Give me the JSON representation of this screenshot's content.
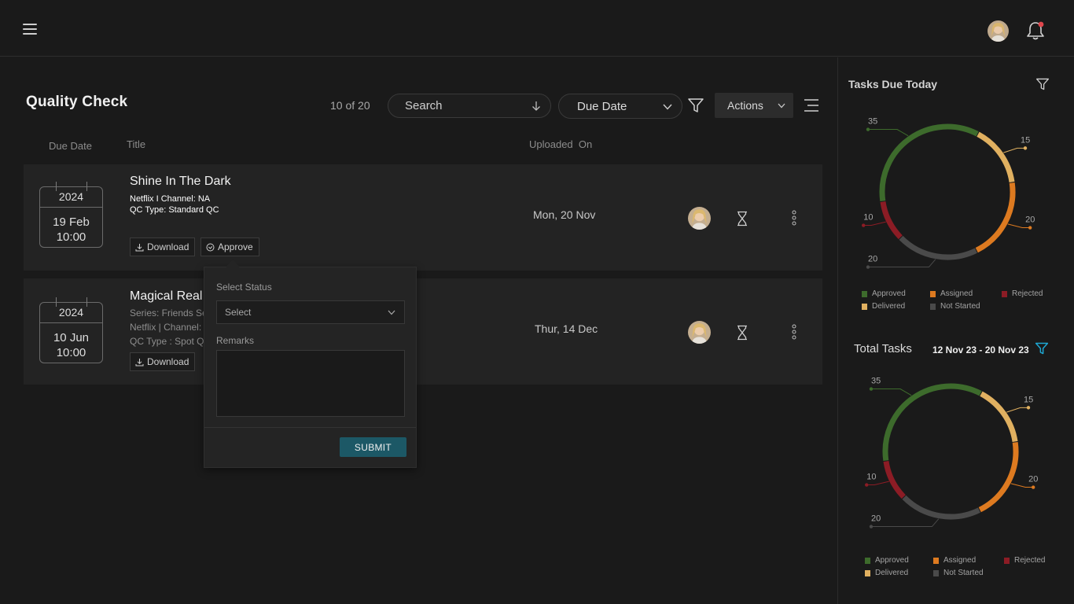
{
  "header": {
    "menu_icon": "hamburger-menu-icon",
    "avatar_icon": "user-avatar-icon",
    "bell_icon": "notification-bell-icon",
    "notification_dot_color": "#e0464c"
  },
  "toolbar": {
    "title": "Quality Check",
    "count": "10 of 20",
    "search_label": "Search",
    "sort_select": "Due Date",
    "actions_label": "Actions"
  },
  "columns": {
    "due_date": "Due Date",
    "title": "Title",
    "uploaded_on": "Uploaded  On"
  },
  "rows": [
    {
      "year": "2024",
      "day": "19 Feb",
      "time": "10:00",
      "title": "Shine In The Dark",
      "meta1": "Netflix I Channel: NA",
      "meta2": "QC Type: Standard QC",
      "uploaded": "Mon, 20 Nov",
      "download_label": "Download",
      "approve_label": "Approve"
    },
    {
      "year": "2024",
      "day": "10 Jun",
      "time": "10:00",
      "title": "Magical Real",
      "meta1": "Series: Friends Se",
      "meta2": "Netflix | Channel:",
      "meta3": "QC Type : Spot Q",
      "uploaded": "Thur, 14 Dec",
      "download_label": "Download"
    }
  ],
  "popover": {
    "status_label": "Select Status",
    "status_placeholder": "Select",
    "remarks_label": "Remarks",
    "submit_label": "SUBMIT"
  },
  "side_panel": {
    "tasks_due_today": {
      "title": "Tasks Due Today"
    },
    "total_tasks": {
      "title": "Total Tasks",
      "date_range": "12 Nov 23 - 20 Nov 23"
    },
    "legend": {
      "approved": "Approved",
      "assigned": "Assigned",
      "rejected": "Rejected",
      "delivered": "Delivered",
      "not_started": "Not Started"
    }
  },
  "colors": {
    "approved": "#3d6b2c",
    "delivered": "#e0b060",
    "assigned": "#dd7a20",
    "not_started": "#4a4a4a",
    "rejected": "#8c1c25",
    "submit": "#1c5866",
    "filter_active": "#1ea7d3"
  },
  "chart_data": [
    {
      "type": "pie",
      "title": "Tasks Due Today",
      "categories": [
        "Approved",
        "Delivered",
        "Assigned",
        "Not Started",
        "Rejected"
      ],
      "values": [
        35,
        15,
        20,
        20,
        10
      ]
    },
    {
      "type": "pie",
      "title": "Total Tasks",
      "categories": [
        "Approved",
        "Delivered",
        "Assigned",
        "Not Started",
        "Rejected"
      ],
      "values": [
        35,
        15,
        20,
        20,
        10
      ]
    }
  ]
}
